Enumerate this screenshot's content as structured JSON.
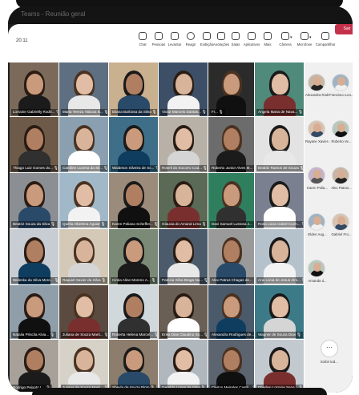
{
  "window_title": "Teams - Reunião geral",
  "toolbar": {
    "time": "20:11",
    "buttons": [
      {
        "label": "Chat",
        "icon": "chat-icon"
      },
      {
        "label": "Pessoas",
        "icon": "people-icon"
      },
      {
        "label": "Levantar",
        "icon": "raise-hand-icon"
      },
      {
        "label": "Reagir",
        "icon": "react-icon"
      },
      {
        "label": "Exibição",
        "icon": "view-icon"
      },
      {
        "label": "Anotações",
        "icon": "notes-icon"
      },
      {
        "label": "Salas",
        "icon": "rooms-icon"
      },
      {
        "label": "Aplicativos",
        "icon": "apps-icon"
      },
      {
        "label": "Mais",
        "icon": "more-icon"
      },
      {
        "label": "Câmera",
        "icon": "camera-icon"
      },
      {
        "label": "Microfone",
        "icon": "microphone-muted-icon"
      },
      {
        "label": "Compartilhar",
        "icon": "share-icon"
      }
    ],
    "leave_label": "Sair",
    "leave_color": "#c4314b"
  },
  "grid": {
    "tiles": [
      "Lorraine Gabrielly Rodri...",
      "Maria Tereza Taboza B...",
      "Eliana Barbosa da Silva",
      "Victor Marcelo Dantas...",
      "Fr...",
      "Angela Maria de Nava...",
      "Thiago Luiz Gomes do...",
      "Caroline Lucena da Sil...",
      "Waldeton Silveira de Sc...",
      "Roseli do Socorro Cod...",
      "Roberto Junior Alves M...",
      "Beatriz Ramos de Souza",
      "Beatriz Souza da Silva",
      "Quélia Albertina Aguiar",
      "Karen Poliana Scheffer...",
      "Glaucia do Amaral Lima",
      "Davi Samuel Lustosa J...",
      "Rosa Lúcia Izabel Cunh...",
      "Waleska da Silva More...",
      "Raquiel Xavier da Silva",
      "Cintia Aline Moreno A...",
      "Patricia Silva Braga Na...",
      "Alex Patrus Chagas de...",
      "Ana Lúcia de Jesus Alm...",
      "Natalia Priscila Alvia...",
      "Juliana de Souza Marti...",
      "Roberta Helena Marcel...",
      "Erika Dias Claudino So...",
      "Alexandra Rodrigues de...",
      "Wagner de Souza Dias",
      "Rodrigo Peixoto L...",
      "Juliana de Souza Marti...",
      "Sheyla de Souza Pinto",
      "Geraldo Lopes da Silva",
      "Cleiton Meireles Castil...",
      "Dhiellen Lorrane Sena..."
    ]
  },
  "panel": {
    "people": [
      "Alexandra Rodri...",
      "Francisco Leo...",
      "Rayane Xavier d...",
      "Roberto Ve...",
      "Karen Polia...",
      "Alex Patrus...",
      "Elden Aug...",
      "Gabriel Fro...",
      "Amanda d..."
    ],
    "more_label": "Exibir tod..."
  },
  "colors": {
    "toolbar_bg": "#ffffff",
    "panel_bg": "#f0f0f0",
    "window_bg": "#1f1f1f"
  }
}
